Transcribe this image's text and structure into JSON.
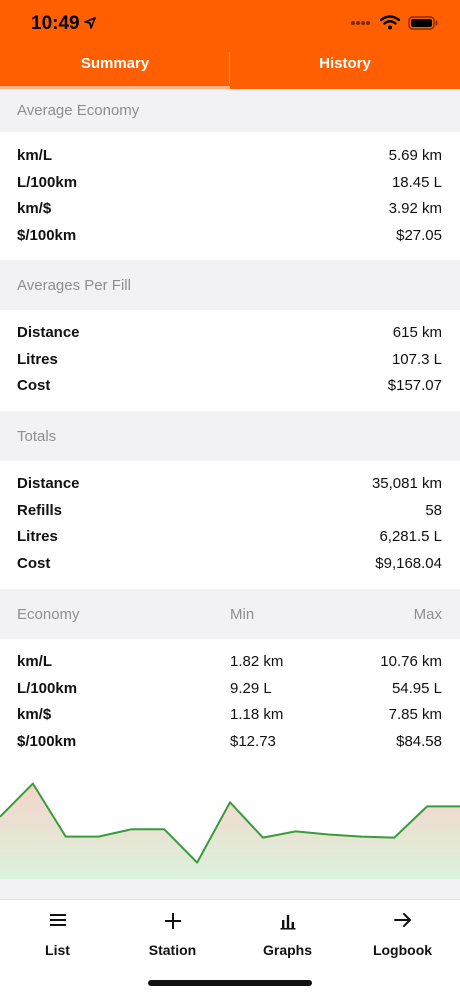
{
  "status_bar": {
    "time": "10:49"
  },
  "tabs": [
    {
      "label": "Summary",
      "active": true
    },
    {
      "label": "History",
      "active": false
    }
  ],
  "colors": {
    "accent": "#ff5f00",
    "chart_line": "#3a9b3a"
  },
  "average_economy": {
    "title": "Average Economy",
    "rows": [
      {
        "label": "km/L",
        "value": "5.69 km"
      },
      {
        "label": "L/100km",
        "value": "18.45 L"
      },
      {
        "label": "km/$",
        "value": "3.92 km"
      },
      {
        "label": "$/100km",
        "value": "$27.05"
      }
    ]
  },
  "averages_per_fill": {
    "title": "Averages Per Fill",
    "rows": [
      {
        "label": "Distance",
        "value": "615 km"
      },
      {
        "label": "Litres",
        "value": "107.3 L"
      },
      {
        "label": "Cost",
        "value": "$157.07"
      }
    ]
  },
  "totals": {
    "title": "Totals",
    "rows": [
      {
        "label": "Distance",
        "value": "35,081 km"
      },
      {
        "label": "Refills",
        "value": "58"
      },
      {
        "label": "Litres",
        "value": "6,281.5 L"
      },
      {
        "label": "Cost",
        "value": "$9,168.04"
      }
    ]
  },
  "economy": {
    "title": "Economy",
    "min_header": "Min",
    "max_header": "Max",
    "rows": [
      {
        "label": "km/L",
        "min": "1.82 km",
        "max": "10.76 km"
      },
      {
        "label": "L/100km",
        "min": "9.29 L",
        "max": "54.95 L"
      },
      {
        "label": "km/$",
        "min": "1.18 km",
        "max": "7.85 km"
      },
      {
        "label": "$/100km",
        "min": "$12.73",
        "max": "$84.58"
      }
    ]
  },
  "chart_data": {
    "type": "area",
    "values": [
      5.4,
      8.6,
      3.5,
      3.5,
      4.2,
      4.2,
      1.0,
      6.8,
      3.4,
      4.0,
      3.7,
      3.5,
      3.4,
      6.4,
      6.4
    ],
    "ylim": [
      0,
      10
    ]
  },
  "tabbar": [
    {
      "label": "List",
      "icon": "list-icon"
    },
    {
      "label": "Station",
      "icon": "plus-icon"
    },
    {
      "label": "Graphs",
      "icon": "bar-chart-icon"
    },
    {
      "label": "Logbook",
      "icon": "arrow-right-icon"
    }
  ]
}
